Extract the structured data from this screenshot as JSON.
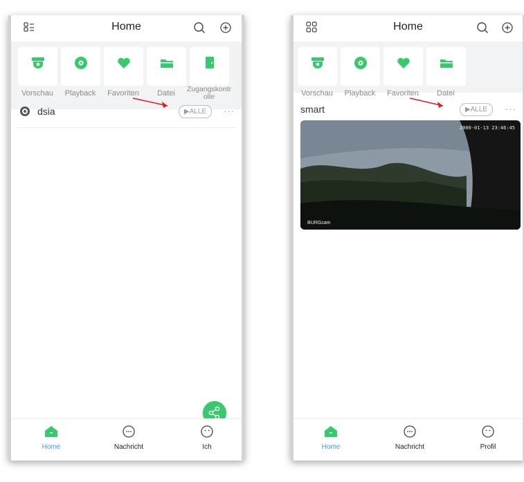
{
  "left": {
    "title": "Home",
    "tiles": [
      "Vorschau",
      "Playback",
      "Favoriten",
      "Datei",
      "Zugangskontrolle"
    ],
    "device": {
      "name": "dsia",
      "alle": "ALLE",
      "more": "···"
    },
    "nav": [
      "Home",
      "Nachricht",
      "Ich"
    ]
  },
  "right": {
    "title": "Home",
    "tiles": [
      "Vorschau",
      "Playback",
      "Favoriten",
      "Datei"
    ],
    "group": {
      "name": "smart",
      "alle": "ALLE",
      "more": "···"
    },
    "camera": {
      "timestamp": "2000-01-13 23:46:45",
      "brand": "BURGcam"
    },
    "nav": [
      "Home",
      "Nachricht",
      "Profil"
    ]
  },
  "colors": {
    "accent_green": "#38c96e",
    "active_blue": "#3a9cf0",
    "annotation_red": "#e02020"
  },
  "icons": [
    "menu-icon",
    "grid-icon",
    "search-icon",
    "plus-icon",
    "camera-icon",
    "playback-icon",
    "heart-icon",
    "folder-icon",
    "door-icon",
    "share-icon",
    "home-icon",
    "message-icon",
    "profile-icon"
  ]
}
